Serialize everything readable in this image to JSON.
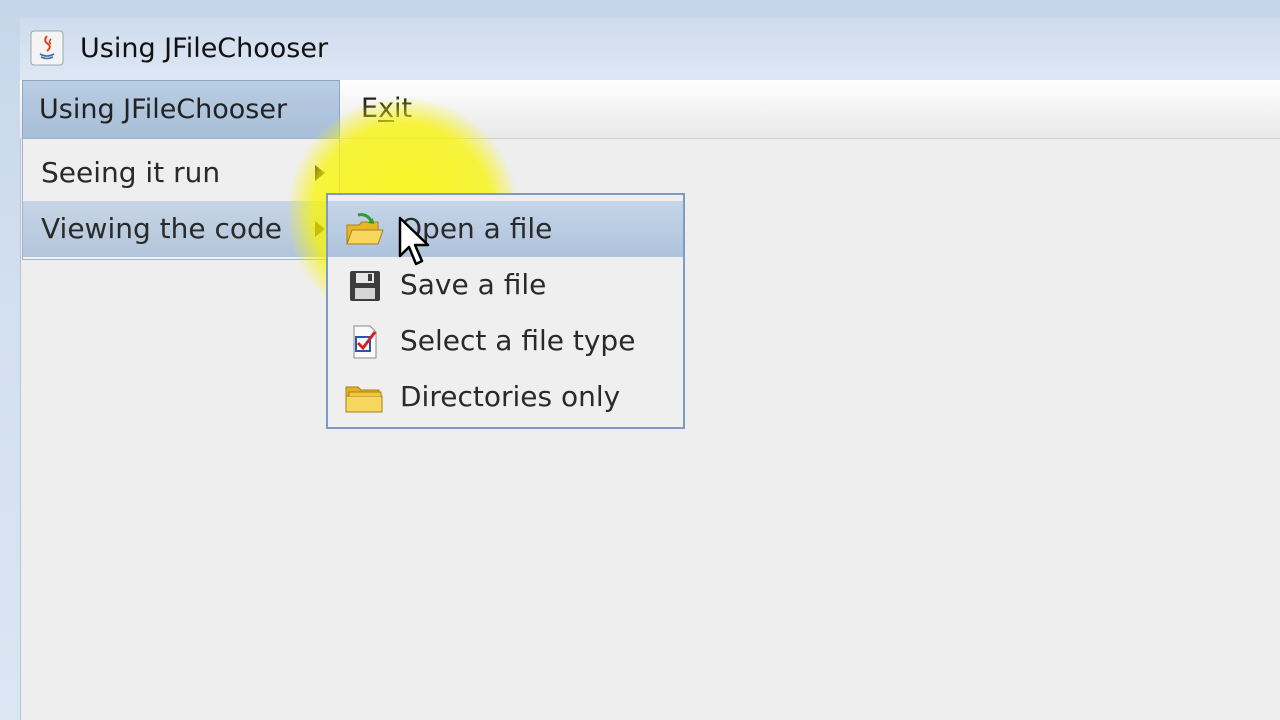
{
  "window": {
    "title": "Using JFileChooser",
    "icon": "java-app-icon"
  },
  "menubar": {
    "items": [
      {
        "label": "Using JFileChooser",
        "state": "open"
      },
      {
        "label": "Exit",
        "mnemonic": "x"
      }
    ]
  },
  "dropdown": {
    "items": [
      {
        "label": "Seeing it run",
        "has_submenu": true
      },
      {
        "label": "Viewing the code",
        "has_submenu": true,
        "selected": true
      }
    ]
  },
  "submenu": {
    "items": [
      {
        "label": "Open a file",
        "icon": "open-folder-icon",
        "selected": true
      },
      {
        "label": "Save a file",
        "icon": "floppy-disk-icon"
      },
      {
        "label": "Select a file type",
        "icon": "checklist-icon"
      },
      {
        "label": "Directories only",
        "icon": "folder-icon"
      }
    ]
  },
  "colors": {
    "highlight": "#faf500",
    "selection": "#b3c5db",
    "menu_border": "#7d9bc7"
  }
}
